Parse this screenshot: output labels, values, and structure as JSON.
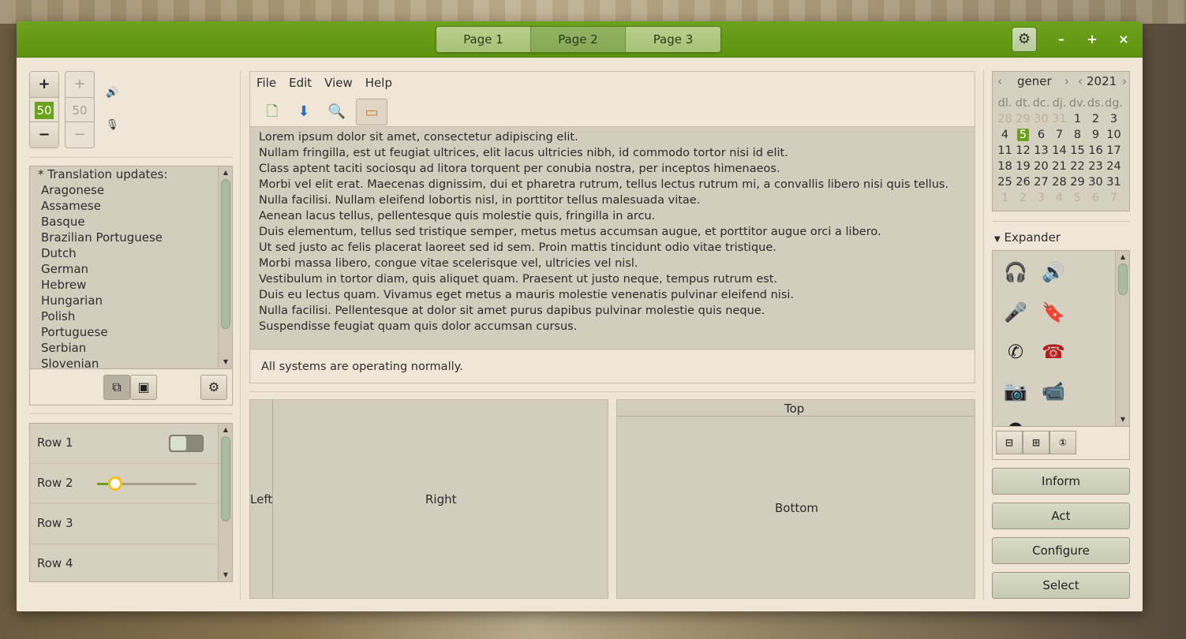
{
  "header": {
    "tabs": [
      {
        "label": "Page 1"
      },
      {
        "label": "Page 2"
      },
      {
        "label": "Page 3"
      }
    ],
    "active_tab": 1,
    "gear": "⚙",
    "minimize": "–",
    "maximize": "+",
    "close": "×",
    "accent": "#6aa11b"
  },
  "left": {
    "spin1": {
      "plus": "+",
      "value": "50",
      "minus": "−"
    },
    "spin2": {
      "plus": "+",
      "value": "50",
      "minus": "−"
    },
    "volume_icon": "🔊",
    "mic_icon": "🎙",
    "list": {
      "items": [
        "* Translation updates:",
        "Aragonese",
        "Assamese",
        "Basque",
        "Brazilian Portuguese",
        "Dutch",
        "German",
        "Hebrew",
        "Hungarian",
        "Polish",
        "Portuguese",
        "Serbian",
        "Slovenian"
      ]
    },
    "rows": [
      {
        "label": "Row 1"
      },
      {
        "label": "Row 2"
      },
      {
        "label": "Row 3"
      },
      {
        "label": "Row 4"
      }
    ],
    "slider_value": 0.2
  },
  "center": {
    "menu": [
      "File",
      "Edit",
      "View",
      "Help"
    ],
    "text_lines": [
      "Lorem ipsum dolor sit amet, consectetur adipiscing elit.",
      "Nullam fringilla, est ut feugiat ultrices, elit lacus ultricies nibh, id commodo tortor nisi id elit.",
      "Class aptent taciti sociosqu ad litora torquent per conubia nostra, per inceptos himenaeos.",
      "Morbi vel elit erat. Maecenas dignissim, dui et pharetra rutrum, tellus lectus rutrum mi, a convallis libero nisi quis tellus.",
      "Nulla facilisi. Nullam eleifend lobortis nisl, in porttitor tellus malesuada vitae.",
      "Aenean lacus tellus, pellentesque quis molestie quis, fringilla in arcu.",
      "Duis elementum, tellus sed tristique semper, metus metus accumsan augue, et porttitor augue orci a libero.",
      "Ut sed justo ac felis placerat laoreet sed id sem. Proin mattis tincidunt odio vitae tristique.",
      "Morbi massa libero, congue vitae scelerisque vel, ultricies vel nisl.",
      "Vestibulum in tortor diam, quis aliquet quam. Praesent ut justo neque, tempus rutrum est.",
      "Duis eu lectus quam. Vivamus eget metus a mauris molestie venenatis pulvinar eleifend nisi.",
      "Nulla facilisi. Pellentesque at dolor sit amet purus dapibus pulvinar molestie quis neque.",
      "Suspendisse feugiat quam quis dolor accumsan cursus."
    ],
    "status": "All systems are operating normally.",
    "pane_left": "Left",
    "pane_right": "Right",
    "pane_top": "Top",
    "pane_bottom": "Bottom"
  },
  "right": {
    "calendar": {
      "month": "gener",
      "year": "2021",
      "weekdays": [
        "dl.",
        "dt.",
        "dc.",
        "dj.",
        "dv.",
        "ds.",
        "dg."
      ],
      "weeks": [
        [
          "28",
          "29",
          "30",
          "31",
          "1",
          "2",
          "3"
        ],
        [
          "4",
          "5",
          "6",
          "7",
          "8",
          "9",
          "10"
        ],
        [
          "11",
          "12",
          "13",
          "14",
          "15",
          "16",
          "17"
        ],
        [
          "18",
          "19",
          "20",
          "21",
          "22",
          "23",
          "24"
        ],
        [
          "25",
          "26",
          "27",
          "28",
          "29",
          "30",
          "31"
        ],
        [
          "1",
          "2",
          "3",
          "4",
          "5",
          "6",
          "7"
        ]
      ],
      "selected": "5"
    },
    "expander": "Expander",
    "buttons": [
      "Inform",
      "Act",
      "Configure",
      "Select"
    ]
  }
}
